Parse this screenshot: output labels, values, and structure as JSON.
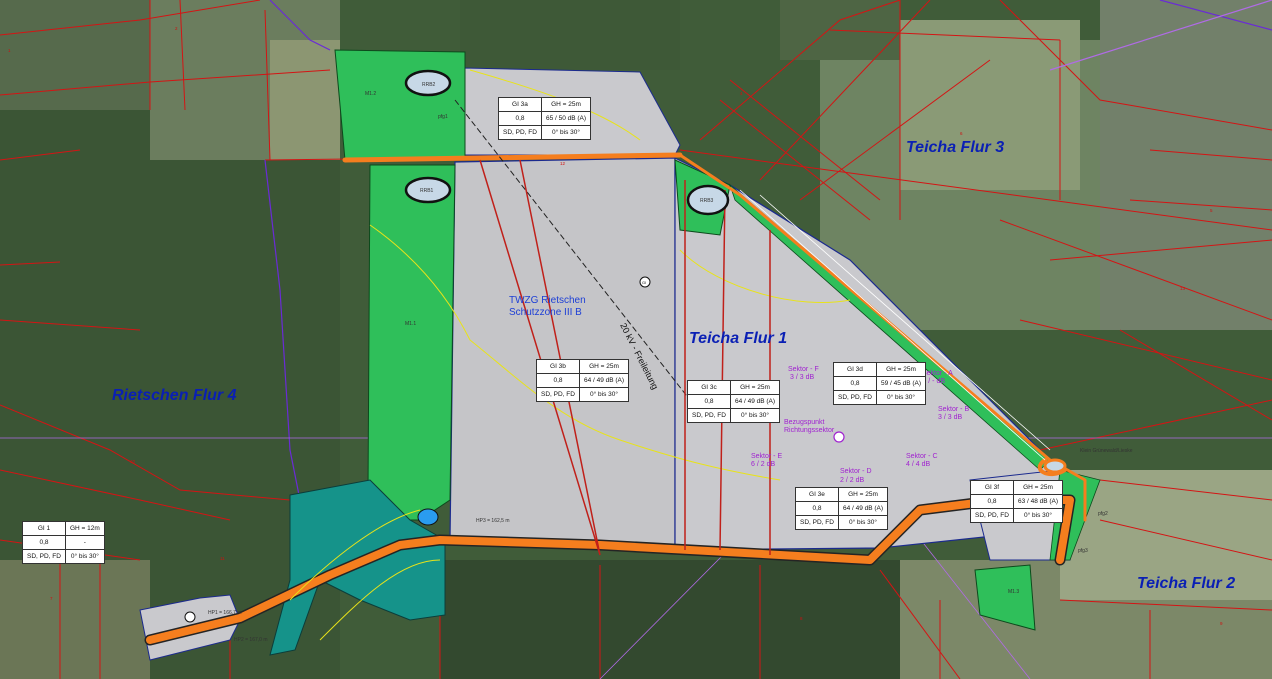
{
  "map": {
    "flur_labels": {
      "teicha_flur_3": "Teicha Flur 3",
      "teicha_flur_1": "Teicha Flur 1",
      "teicha_flur_2": "Teicha Flur 2",
      "rietschen_flur_4": "Rietschen Flur 4"
    },
    "twzg": {
      "line1": "TWZG Rietschen",
      "line2": "Schutzzone III B"
    },
    "powerline_label": "20 kV - Freileitung",
    "bezugspunkt": {
      "line1": "Bezugspunkt",
      "line2": "Richtungssektor"
    },
    "sektoren": {
      "a": {
        "name": "Sektor - A",
        "value": "- / - dB"
      },
      "b": {
        "name": "Sektor - B",
        "value": "3 / 3 dB"
      },
      "c": {
        "name": "Sektor - C",
        "value": "4 / 4 dB"
      },
      "d": {
        "name": "Sektor - D",
        "value": "2 / 2 dB"
      },
      "e": {
        "name": "Sektor - E",
        "value": "6 / 2 dB"
      },
      "f": {
        "name": "Sektor - F",
        "value": "3 / 3 dB"
      }
    },
    "basin_labels": {
      "rrb1": "RRB1",
      "rrb2": "RRB2",
      "rrb3": "RRB3"
    },
    "height_points": {
      "hp1": "HP1 = 166,7 m",
      "hp2": "HP2 = 167,0 m",
      "hp3": "HP3 = 162,5 m"
    },
    "gi_marker": "GI",
    "area_codes": {
      "m1_1": "M1.1",
      "m1_2": "M1.2",
      "m1_3": "M1.3",
      "pfg1": "pfg1",
      "pfg2": "pfg2",
      "pfg3": "pfg3"
    },
    "road_label": "Klein Grünewald/Lieske"
  },
  "boxes": {
    "gi1": {
      "name": "GI 1",
      "gh": "GH = 12m",
      "grz": "0,8",
      "db": "-",
      "roof": "SD, PD, FD",
      "angle": "0° bis 30°"
    },
    "gi3a": {
      "name": "GI 3a",
      "gh": "GH = 25m",
      "grz": "0,8",
      "db": "65 / 50 dB (A)",
      "roof": "SD, PD, FD",
      "angle": "0° bis 30°"
    },
    "gi3b": {
      "name": "GI 3b",
      "gh": "GH = 25m",
      "grz": "0,8",
      "db": "64 / 49 dB (A)",
      "roof": "SD, PD, FD",
      "angle": "0° bis 30°"
    },
    "gi3c": {
      "name": "GI 3c",
      "gh": "GH = 25m",
      "grz": "0,8",
      "db": "64 / 49 dB (A)",
      "roof": "SD, PD, FD",
      "angle": "0° bis 30°"
    },
    "gi3d": {
      "name": "GI 3d",
      "gh": "GH = 25m",
      "grz": "0,8",
      "db": "59 / 45 dB (A)",
      "roof": "SD, PD, FD",
      "angle": "0° bis 30°"
    },
    "gi3e": {
      "name": "GI 3e",
      "gh": "GH = 25m",
      "grz": "0,8",
      "db": "64 / 49 dB (A)",
      "roof": "SD, PD, FD",
      "angle": "0° bis 30°"
    },
    "gi3f": {
      "name": "GI 3f",
      "gh": "GH = 25m",
      "grz": "0,8",
      "db": "63 / 48 dB (A)",
      "roof": "SD, PD, FD",
      "angle": "0° bis 30°"
    }
  }
}
